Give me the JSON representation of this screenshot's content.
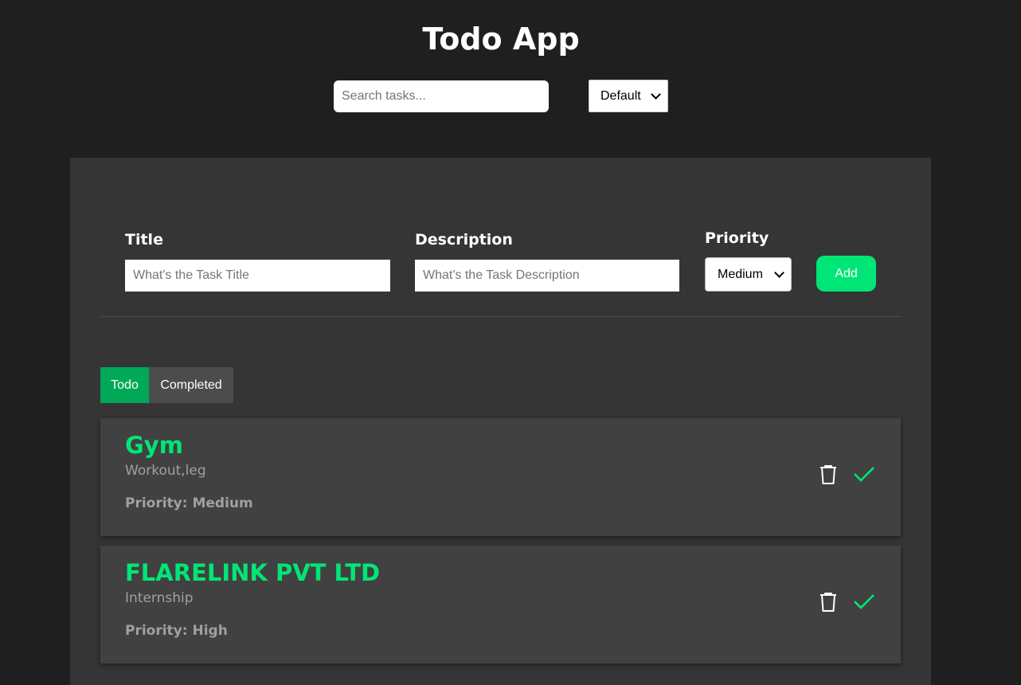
{
  "app": {
    "title": "Todo App"
  },
  "toolbar": {
    "search_placeholder": "Search tasks...",
    "sort_selected": "Default"
  },
  "form": {
    "title_label": "Title",
    "title_placeholder": "What's the Task Title",
    "description_label": "Description",
    "description_placeholder": "What's the Task Description",
    "priority_label": "Priority",
    "priority_selected": "Medium",
    "add_label": "Add"
  },
  "tabs": [
    {
      "label": "Todo",
      "active": true
    },
    {
      "label": "Completed",
      "active": false
    }
  ],
  "todos": [
    {
      "title": "Gym",
      "description": "Workout,leg",
      "priority": "Priority: Medium"
    },
    {
      "title": "FLARELINK PVT LTD",
      "description": "Internship",
      "priority": "Priority: High"
    }
  ],
  "icons": {
    "delete": "trash-icon",
    "complete": "check-icon"
  },
  "colors": {
    "background": "#1f1f1f",
    "panel": "#353535",
    "card": "#414141",
    "accent": "#00e676",
    "tab_active": "#00a958",
    "tab_inactive": "#4c4c4c",
    "muted_text": "#a0a0a0"
  }
}
